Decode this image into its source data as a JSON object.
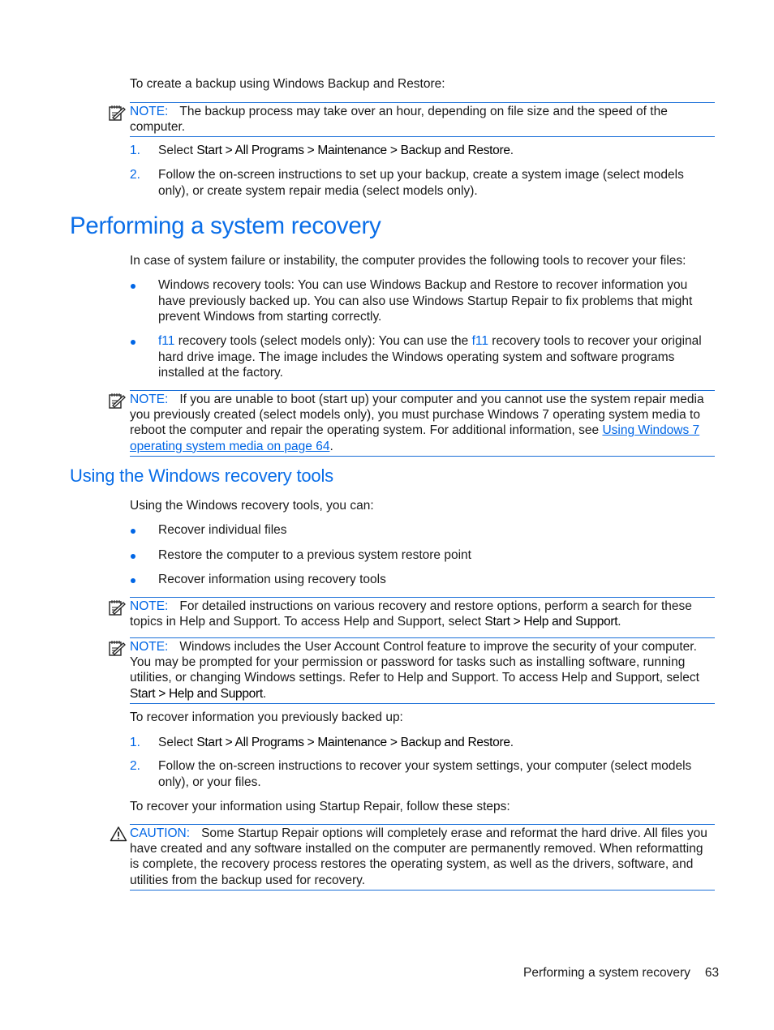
{
  "intro": "To create a backup using Windows Backup and Restore:",
  "notes": {
    "label": "NOTE:",
    "backup_time": "The backup process may take over an hour, depending on file size and the speed of the computer.",
    "unable_boot_pre": "If you are unable to boot (start up) your computer and you cannot use the system repair media you previously created (select models only), you must purchase Windows 7 operating system media to reboot the computer and repair the operating system. For additional information, see ",
    "unable_boot_link": "Using Windows 7 operating system media on page 64",
    "unable_boot_post": ".",
    "detailed_pre": "For detailed instructions on various recovery and restore options, perform a search for these topics in Help and Support. To access Help and Support, select ",
    "detailed_bold": "Start > Help and Support",
    "detailed_post": ".",
    "uac_pre": "Windows includes the User Account Control feature to improve the security of your computer. You may be prompted for your permission or password for tasks such as installing software, running utilities, or changing Windows settings. Refer to Help and Support. To access Help and Support, select ",
    "uac_bold": "Start > Help and Support",
    "uac_post": "."
  },
  "backup_steps": [
    {
      "num": "1.",
      "pre": "Select ",
      "bold": "Start > All Programs > Maintenance > Backup and Restore",
      "post": "."
    },
    {
      "num": "2.",
      "text": "Follow the on-screen instructions to set up your backup, create a system image (select models only), or create system repair media (select models only)."
    }
  ],
  "section1": {
    "title": "Performing a system recovery",
    "intro": "In case of system failure or instability, the computer provides the following tools to recover your files:",
    "bullets": [
      {
        "text": "Windows recovery tools: You can use Windows Backup and Restore to recover information you have previously backed up. You can also use Windows Startup Repair to fix problems that might prevent Windows from starting correctly."
      },
      {
        "key": "f11",
        "mid": " recovery tools (select models only): You can use the ",
        "key2": "f11",
        "post": " recovery tools to recover your original hard drive image. The image includes the Windows operating system and software programs installed at the factory."
      }
    ]
  },
  "section2": {
    "title": "Using the Windows recovery tools",
    "intro": "Using the Windows recovery tools, you can:",
    "bullets": [
      "Recover individual files",
      "Restore the computer to a previous system restore point",
      "Recover information using recovery tools"
    ],
    "recover_intro": "To recover information you previously backed up:",
    "recover_steps": [
      {
        "num": "1.",
        "pre": "Select ",
        "bold": "Start > All Programs > Maintenance > Backup and Restore",
        "post": "."
      },
      {
        "num": "2.",
        "text": "Follow the on-screen instructions to recover your system settings, your computer (select models only), or your files."
      }
    ],
    "startup_intro": "To recover your information using Startup Repair, follow these steps:"
  },
  "caution": {
    "label": "CAUTION:",
    "text": "Some Startup Repair options will completely erase and reformat the hard drive. All files you have created and any software installed on the computer are permanently removed. When reformatting is complete, the recovery process restores the operating system, as well as the drivers, software, and utilities from the backup used for recovery."
  },
  "footer": {
    "section": "Performing a system recovery",
    "page": "63"
  },
  "colors": {
    "accent": "#0066e6",
    "rule": "#1a6fd8"
  }
}
